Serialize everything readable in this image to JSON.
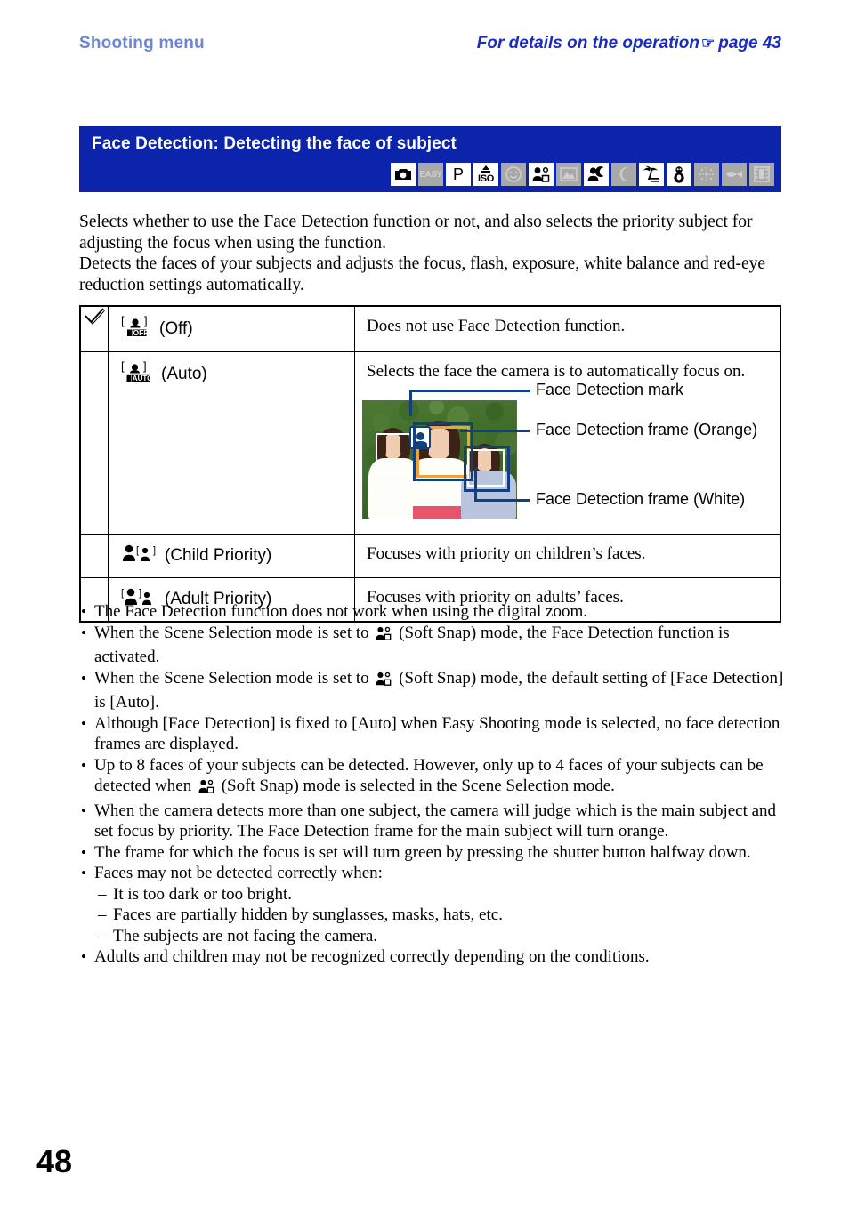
{
  "header": {
    "left": "Shooting menu",
    "right_text": "For details on the operation",
    "right_pointer": "☞",
    "right_page": "page 43"
  },
  "band": {
    "title": "Face Detection: Detecting the face of subject",
    "mode_icons": [
      {
        "name": "camera-auto-icon",
        "label": "",
        "enabled": true
      },
      {
        "name": "easy-shooting-icon",
        "label": "EASY",
        "enabled": false
      },
      {
        "name": "program-auto-icon",
        "label": "P",
        "enabled": true
      },
      {
        "name": "high-sensitivity-iso-icon",
        "label": "ISO",
        "enabled": true
      },
      {
        "name": "smile-shutter-icon",
        "label": "",
        "enabled": false
      },
      {
        "name": "soft-snap-icon",
        "label": "",
        "enabled": true
      },
      {
        "name": "landscape-icon",
        "label": "",
        "enabled": false
      },
      {
        "name": "twilight-portrait-icon",
        "label": "",
        "enabled": true
      },
      {
        "name": "twilight-icon",
        "label": "",
        "enabled": false
      },
      {
        "name": "beach-icon",
        "label": "",
        "enabled": true
      },
      {
        "name": "snow-icon",
        "label": "",
        "enabled": true
      },
      {
        "name": "fireworks-icon",
        "label": "",
        "enabled": false
      },
      {
        "name": "underwater-icon",
        "label": "",
        "enabled": false
      },
      {
        "name": "movie-icon",
        "label": "",
        "enabled": false
      }
    ]
  },
  "intro": {
    "p1": "Selects whether to use the Face Detection function or not, and also selects the priority subject for adjusting the focus when using the function.",
    "p2": "Detects the faces of your subjects and adjusts the focus, flash, exposure, white balance and red-eye reduction settings automatically."
  },
  "table": {
    "rows": [
      {
        "checked": true,
        "icon": "face-detection-off-icon",
        "option": "(Off)",
        "description": "Does not use Face Detection function."
      },
      {
        "checked": false,
        "icon": "face-detection-auto-icon",
        "option": "(Auto)",
        "description": "Selects the face the camera is to automatically focus on."
      },
      {
        "checked": false,
        "icon": "child-priority-icon",
        "option": "(Child Priority)",
        "description": "Focuses with priority on children’s faces."
      },
      {
        "checked": false,
        "icon": "adult-priority-icon",
        "option": "(Adult Priority)",
        "description": "Focuses with priority on adults’ faces."
      }
    ]
  },
  "figure": {
    "callout_mark": "Face Detection mark",
    "callout_orange": "Face Detection frame (Orange)",
    "callout_white": "Face Detection frame (White)"
  },
  "notes": {
    "items": [
      "The Face Detection function does not work when using the digital zoom.",
      "When the Scene Selection mode is set to ",
      "When the Scene Selection mode is set to ",
      "Although [Face Detection] is fixed to [Auto] when Easy Shooting mode is selected, no face detection frames are displayed.",
      "Up to 8 faces of your subjects can be detected. However, only up to 4 faces of your subjects can be detected when ",
      "When the camera detects more than one subject, the camera will judge which is the main subject and set focus by priority. The Face Detection frame for the main subject will turn orange.",
      "The frame for which the focus is set will turn green by pressing the shutter button halfway down.",
      "Faces may not be detected correctly when:",
      "Adults and children may not be recognized correctly depending on the conditions."
    ],
    "note2_tail": " (Soft Snap) mode, the Face Detection function is activated.",
    "note3_tail": " (Soft Snap) mode, the default setting of [Face Detection] is [Auto].",
    "note5_tail": " (Soft Snap) mode is selected in the Scene Selection mode.",
    "sub_items": [
      "It is too dark or too bright.",
      "Faces are partially hidden by sunglasses, masks, hats, etc.",
      "The subjects are not facing the camera."
    ]
  },
  "folio": "48",
  "colors": {
    "band_blue": "#0c24ab",
    "header_left_blue": "#6b86d6",
    "header_right_blue": "#1a2cc0",
    "callout_line": "#123f7d",
    "frame_orange": "#f2a23a",
    "frame_white": "#ffffff"
  }
}
